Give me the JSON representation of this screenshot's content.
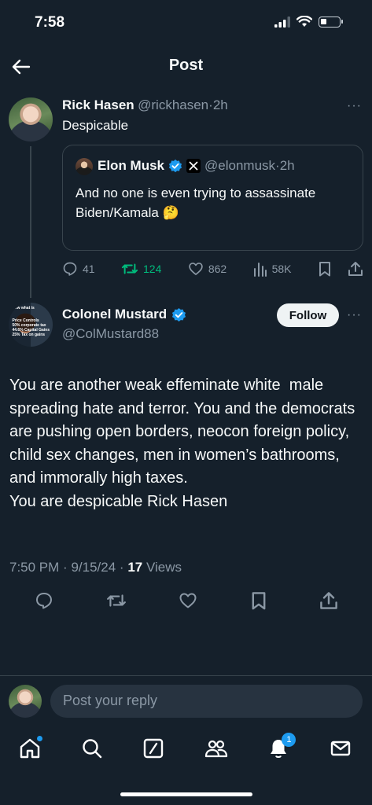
{
  "status_bar": {
    "time": "7:58"
  },
  "header": {
    "title": "Post"
  },
  "parent_post": {
    "name": "Rick Hasen",
    "handle": "@rickhasen",
    "sep": "·",
    "time": "2h",
    "text": "Despicable",
    "more": "···",
    "quote": {
      "name": "Elon Musk",
      "handle": "@elonmusk",
      "sep": "·",
      "time": "2h",
      "text": "And no one is even trying to assassinate Biden/Kamala 🤔"
    },
    "stats": {
      "replies": "41",
      "reposts": "124",
      "likes": "862",
      "views": "58K"
    }
  },
  "main_post": {
    "name": "Colonel Mustard",
    "handle": "@ColMustard88",
    "follow_label": "Follow",
    "more": "···",
    "avatar_overlay_text": [
      "how what is",
      "Price Controls",
      "50% corporate tax",
      "44.6% Capital Gains",
      "25% Tax on gains"
    ],
    "text": "You are another weak effeminate white  male spreading hate and terror. You and the democrats are pushing open borders, neocon foreign policy, child sex changes, men in women’s bathrooms, and immorally high taxes.\nYou are despicable Rick Hasen",
    "time": "7:50 PM",
    "sep": "·",
    "date": "9/15/24",
    "sep2": "·",
    "views_count": "17",
    "views_label": "Views"
  },
  "reply": {
    "placeholder": "Post your reply"
  },
  "bottom_nav": {
    "notifications_badge": "1"
  },
  "colors": {
    "background": "#15202b",
    "accent": "#1d9bf0",
    "repost_green": "#00ba7c",
    "muted": "#8b98a5"
  }
}
